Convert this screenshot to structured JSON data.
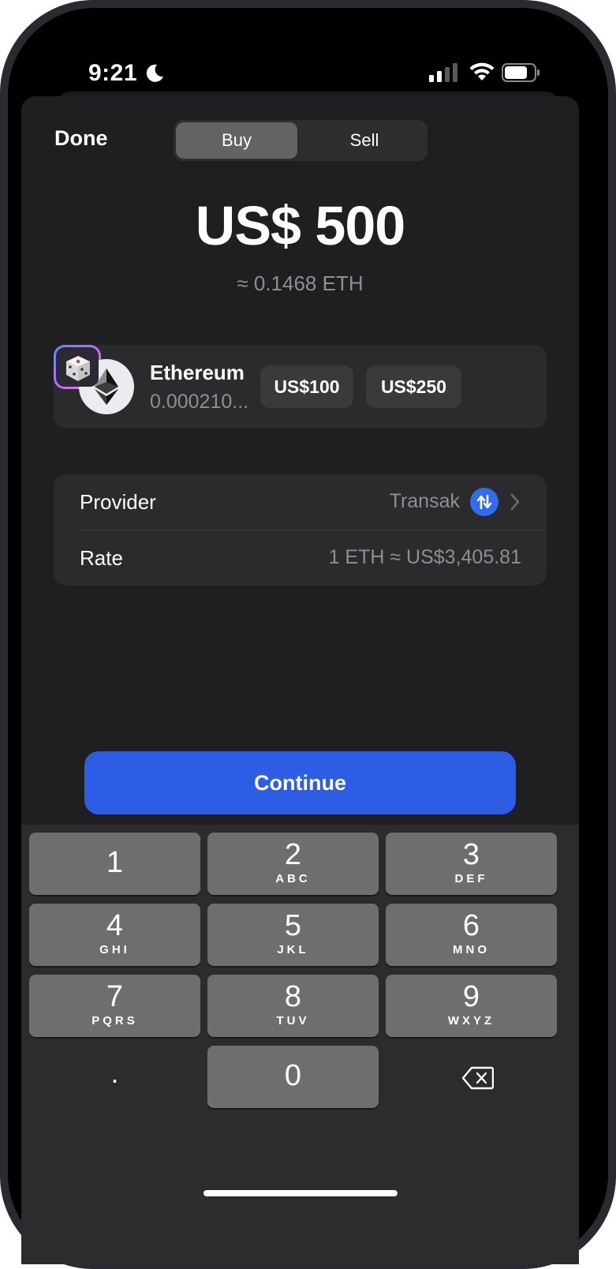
{
  "status_bar": {
    "time": "9:21",
    "icons": [
      "moon-icon",
      "cellular-signal-icon",
      "wifi-icon",
      "battery-icon"
    ]
  },
  "header": {
    "done_label": "Done",
    "segments": [
      "Buy",
      "Sell"
    ],
    "selected_segment": "Buy"
  },
  "amount": {
    "fiat": "US$ 500",
    "crypto_approx": "≈ 0.1468 ETH"
  },
  "asset": {
    "name": "Ethereum",
    "balance": "0.000210...",
    "icon": "ethereum-icon",
    "quick_amounts": [
      "US$100",
      "US$250"
    ],
    "random_icon": "dice-icon"
  },
  "details": {
    "provider_label": "Provider",
    "provider_value": "Transak",
    "rate_label": "Rate",
    "rate_value": "1 ETH ≈ US$3,405.81"
  },
  "continue_label": "Continue",
  "keypad": {
    "keys": [
      {
        "num": "1",
        "letters": ""
      },
      {
        "num": "2",
        "letters": "ABC"
      },
      {
        "num": "3",
        "letters": "DEF"
      },
      {
        "num": "4",
        "letters": "GHI"
      },
      {
        "num": "5",
        "letters": "JKL"
      },
      {
        "num": "6",
        "letters": "MNO"
      },
      {
        "num": "7",
        "letters": "PQRS"
      },
      {
        "num": "8",
        "letters": "TUV"
      },
      {
        "num": "9",
        "letters": "WXYZ"
      },
      {
        "num": "0",
        "letters": ""
      }
    ],
    "decimal": ".",
    "delete_icon": "backspace-icon"
  },
  "colors": {
    "accent": "#2d5ce5",
    "sheet_bg": "#1f1f21",
    "card_bg": "#2b2b2e",
    "key_bg": "#6e6e70"
  }
}
